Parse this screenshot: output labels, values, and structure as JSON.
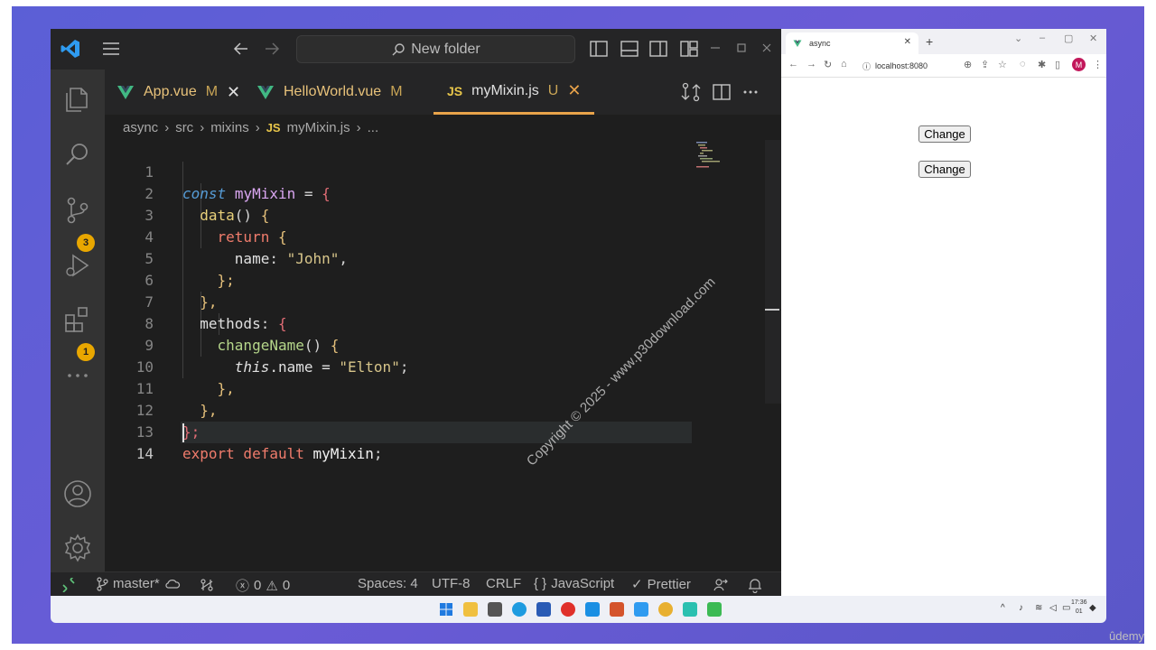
{
  "vscode": {
    "search_label": "New folder",
    "tabs": [
      {
        "label": "App.vue",
        "modifier": "M"
      },
      {
        "label": "HelloWorld.vue",
        "modifier": "M"
      },
      {
        "label": "myMixin.js",
        "modifier": "U"
      }
    ],
    "breadcrumb": [
      "async",
      "src",
      "mixins",
      "myMixin.js",
      "..."
    ],
    "breadcrumb_js": "JS",
    "tab_js": "JS",
    "line_numbers": [
      "1",
      "2",
      "3",
      "4",
      "5",
      "6",
      "7",
      "8",
      "9",
      "10",
      "11",
      "12",
      "13",
      "14"
    ],
    "code": {
      "l1_const": "const",
      "l1_name": "myMixin",
      "l1_eq": " = ",
      "l1_brace": "{",
      "l2_fn": "data",
      "l2_rest": "() ",
      "l2_brace": "{",
      "l3_kw": "return",
      "l3_brace": "{",
      "l4_prop": "name",
      "l4_colon": ": ",
      "l4_str": "\"John\"",
      "l4_comma": ",",
      "l5": "};",
      "l6": "},",
      "l7_prop": "methods",
      "l7_colon": ": ",
      "l7_brace": "{",
      "l8_fn": "changeName",
      "l8_rest": "() ",
      "l8_brace": "{",
      "l9_this": "this",
      "l9_prop": ".name = ",
      "l9_str": "\"Elton\"",
      "l9_semi": ";",
      "l10": "},",
      "l11": "},",
      "l12": "};",
      "l13_kw": "export default",
      "l13_name": " myMixin",
      "l13_semi": ";"
    },
    "badges": {
      "source_control": "3",
      "extensions": "1"
    },
    "status": {
      "branch": "master*",
      "errors": "0",
      "warnings": "0",
      "spaces": "Spaces: 4",
      "encoding": "UTF-8",
      "eol": "CRLF",
      "language": "JavaScript",
      "language_icon": "{ }",
      "prettier": "Prettier"
    },
    "watermark": "Copyright © 2025 - www.p30download.com"
  },
  "browser": {
    "tab_title": "async",
    "url": "localhost:8080",
    "avatar": "M",
    "buttons": [
      "Change",
      "Change"
    ]
  },
  "taskbar": {
    "clock_time": "17:36",
    "clock_date": "01"
  },
  "brand": "ûdemy",
  "colors": {
    "editor_bg": "#1e1e1e",
    "activity_bg": "#333333",
    "badge": "#e9a700",
    "tab_active_border": "#e8a34a",
    "desktop": "#5b5fd6"
  }
}
